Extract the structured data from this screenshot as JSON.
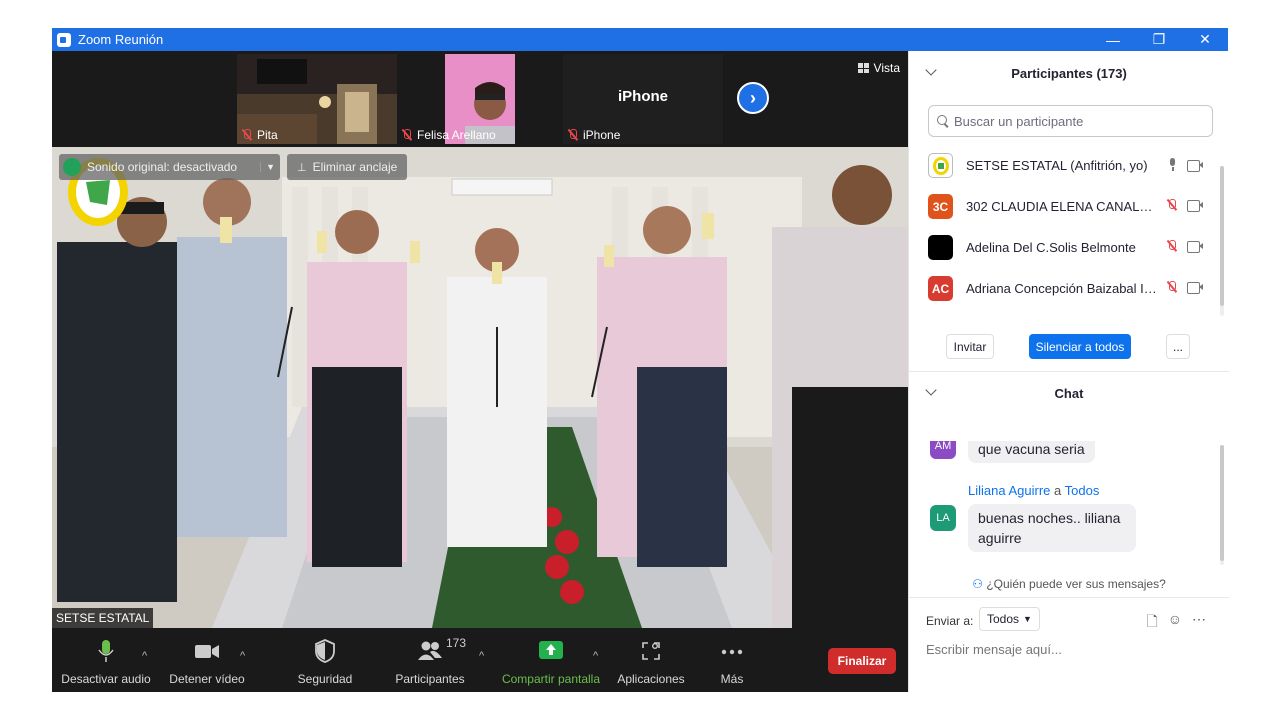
{
  "window": {
    "title": "Zoom Reunión",
    "controls": [
      "—",
      "❐",
      "✕"
    ]
  },
  "strip": {
    "thumbs": [
      {
        "name": "Pita"
      },
      {
        "name": "Felisa Arellano"
      },
      {
        "name": "iPhone",
        "center_label": "iPhone"
      }
    ],
    "view_label": "Vista"
  },
  "main_video": {
    "sound_label": "Sonido original: desactivado",
    "unpin_label": "Eliminar anclaje",
    "speaker_name": "SETSE ESTATAL"
  },
  "toolbar": {
    "mute_label": "Desactivar audio",
    "video_label": "Detener vídeo",
    "security_label": "Seguridad",
    "participants_label": "Participantes",
    "participants_count": "173",
    "share_label": "Compartir pantalla",
    "apps_label": "Aplicaciones",
    "more_label": "Más",
    "end_label": "Finalizar"
  },
  "participants": {
    "header": "Participantes (173)",
    "search_placeholder": "Buscar un participante",
    "list": [
      {
        "name": "SETSE ESTATAL (Anfitrión, yo)",
        "initials": "",
        "color": "#e8e6c8",
        "mic": "on"
      },
      {
        "name": "302 CLAUDIA ELENA CANALES ...",
        "initials": "3C",
        "color": "#e0541c",
        "mic": "off"
      },
      {
        "name": "Adelina Del C.Solis Belmonte",
        "initials": "",
        "color": "#000000",
        "mic": "off"
      },
      {
        "name": "Adriana Concepción Baizabal Ib...",
        "initials": "AC",
        "color": "#d83b2f",
        "mic": "off"
      }
    ],
    "invite_label": "Invitar",
    "mute_all_label": "Silenciar a todos",
    "more_label": "..."
  },
  "chat": {
    "header": "Chat",
    "messages": [
      {
        "initials": "AM",
        "color": "#8b4bc4",
        "text": "que vacuna seria"
      },
      {
        "initials": "LA",
        "color": "#1d9a76",
        "sender": "Liliana Aguirre",
        "to_word": "a",
        "recipient": "Todos",
        "text_line1": "buenas noches.. liliana",
        "text_line2": "aguirre"
      }
    ],
    "who_can_see": "¿Quién puede ver sus mensajes?",
    "send_to_label": "Enviar a:",
    "send_to_value": "Todos",
    "compose_placeholder": "Escribir mensaje aquí..."
  }
}
